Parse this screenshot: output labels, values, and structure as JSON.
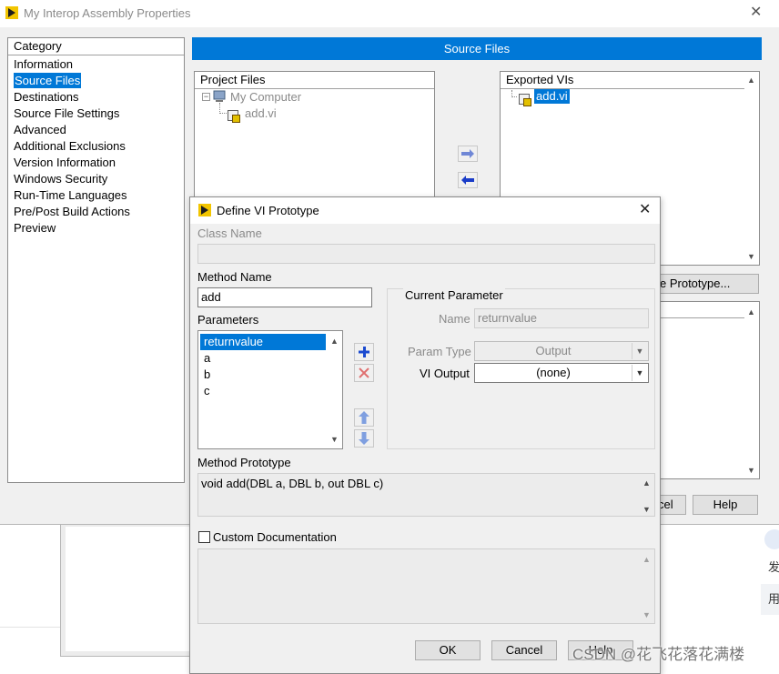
{
  "main_window": {
    "title": "My Interop Assembly Properties",
    "close_glyph": "✕",
    "category_label": "Category",
    "categories": [
      "Information",
      "Source Files",
      "Destinations",
      "Source File Settings",
      "Advanced",
      "Additional Exclusions",
      "Version Information",
      "Windows Security",
      "Run-Time Languages",
      "Pre/Post Build Actions",
      "Preview"
    ],
    "banner": "Source Files",
    "project_files_label": "Project Files",
    "project_root": "My Computer",
    "project_child": "add.vi",
    "exported_label": "Exported VIs",
    "exported_item": "add.vi",
    "define_prototype_label": "e Prototype...",
    "cancel_partial": "cel",
    "help_label": "Help"
  },
  "dialog": {
    "title": "Define VI Prototype",
    "close_glyph": "✕",
    "class_name_label": "Class Name",
    "method_name_label": "Method Name",
    "method_name_value": "add",
    "parameters_label": "Parameters",
    "parameters": [
      "returnvalue",
      "a",
      "b",
      "c"
    ],
    "current_parameter_label": "Current Parameter",
    "name_label": "Name",
    "name_value": "returnvalue",
    "param_type_label": "Param Type",
    "param_type_value": "Output",
    "vi_output_label": "VI Output",
    "vi_output_value": "(none)",
    "method_prototype_label": "Method Prototype",
    "method_prototype_value": "void add(DBL a, DBL b, out DBL c)",
    "custom_doc_label": "Custom Documentation",
    "ok_label": "OK",
    "cancel_label": "Cancel",
    "help_label": "Help"
  },
  "background": {
    "side_char_1": "发",
    "side_char_2": "用"
  },
  "watermark": "CSDN @花飞花落花满楼",
  "colors": {
    "accent": "#0078d7",
    "arrow_right": "#6f87d6",
    "arrow_left": "#1a3cc8",
    "remove_red": "#e07070",
    "logo_yellow": "#f2c500"
  }
}
